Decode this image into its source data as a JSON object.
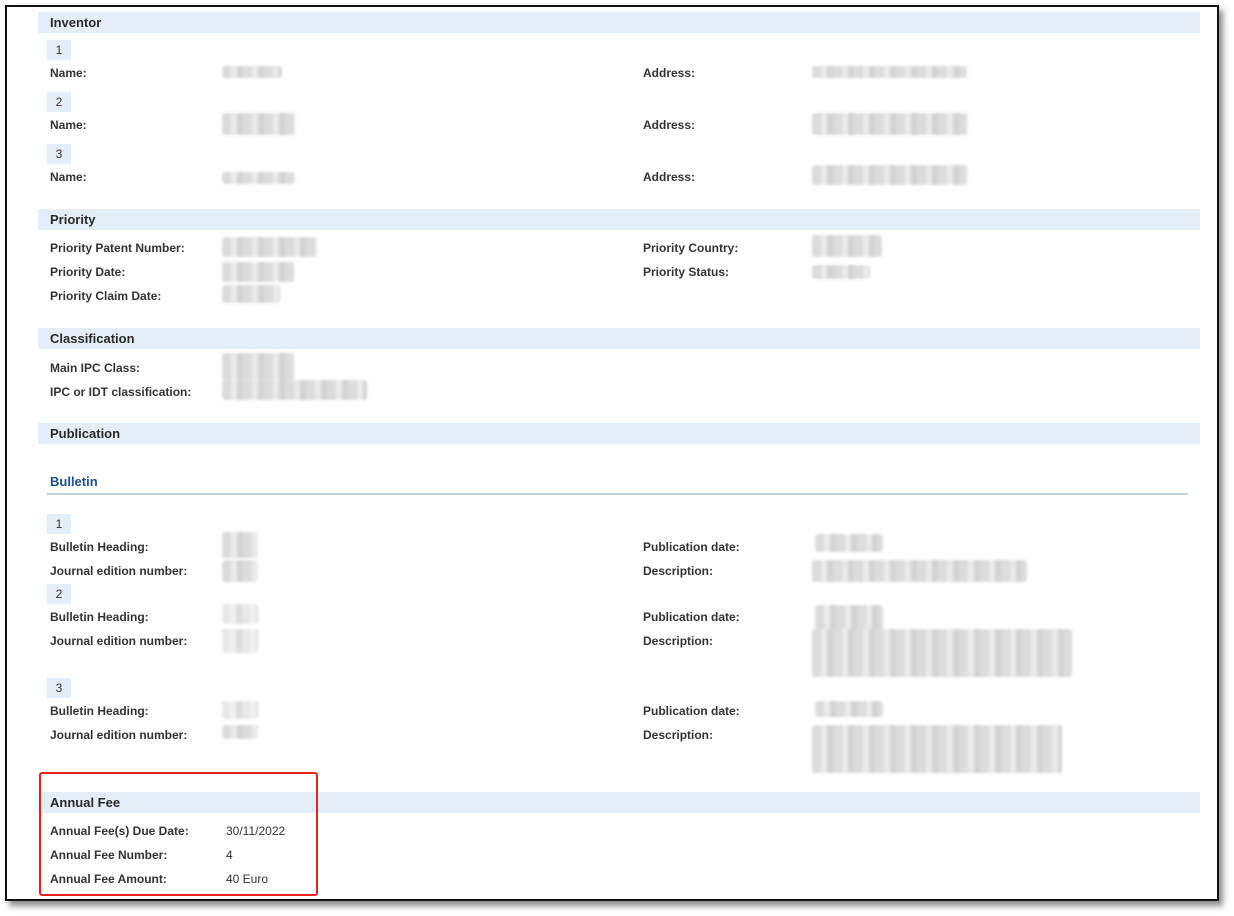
{
  "sections": {
    "inventor": {
      "title": "Inventor",
      "entries": [
        {
          "num": "1",
          "name_label": "Name:",
          "address_label": "Address:"
        },
        {
          "num": "2",
          "name_label": "Name:",
          "address_label": "Address:"
        },
        {
          "num": "3",
          "name_label": "Name:",
          "address_label": "Address:"
        }
      ]
    },
    "priority": {
      "title": "Priority",
      "patent_number_label": "Priority Patent Number:",
      "date_label": "Priority Date:",
      "claim_date_label": "Priority Claim Date:",
      "country_label": "Priority Country:",
      "status_label": "Priority Status:"
    },
    "classification": {
      "title": "Classification",
      "main_ipc_label": "Main IPC Class:",
      "ipc_idt_label": "IPC or IDT classification:"
    },
    "publication": {
      "title": "Publication",
      "bulletin_title": "Bulletin",
      "entries": [
        {
          "num": "1",
          "heading_label": "Bulletin Heading:",
          "journal_label": "Journal edition number:",
          "pub_date_label": "Publication date:",
          "description_label": "Description:"
        },
        {
          "num": "2",
          "heading_label": "Bulletin Heading:",
          "journal_label": "Journal edition number:",
          "pub_date_label": "Publication date:",
          "description_label": "Description:"
        },
        {
          "num": "3",
          "heading_label": "Bulletin Heading:",
          "journal_label": "Journal edition number:",
          "pub_date_label": "Publication date:",
          "description_label": "Description:"
        }
      ]
    },
    "annual_fee": {
      "title": "Annual Fee",
      "due_date_label": "Annual Fee(s) Due Date:",
      "due_date_value": "30/11/2022",
      "number_label": "Annual Fee Number:",
      "number_value": "4",
      "amount_label": "Annual Fee Amount:",
      "amount_value": "40 Euro"
    }
  },
  "colors": {
    "section_header_bg": "#e4eef8",
    "bulletin_title": "#1f4e8c",
    "highlight_border": "#e8231e"
  }
}
